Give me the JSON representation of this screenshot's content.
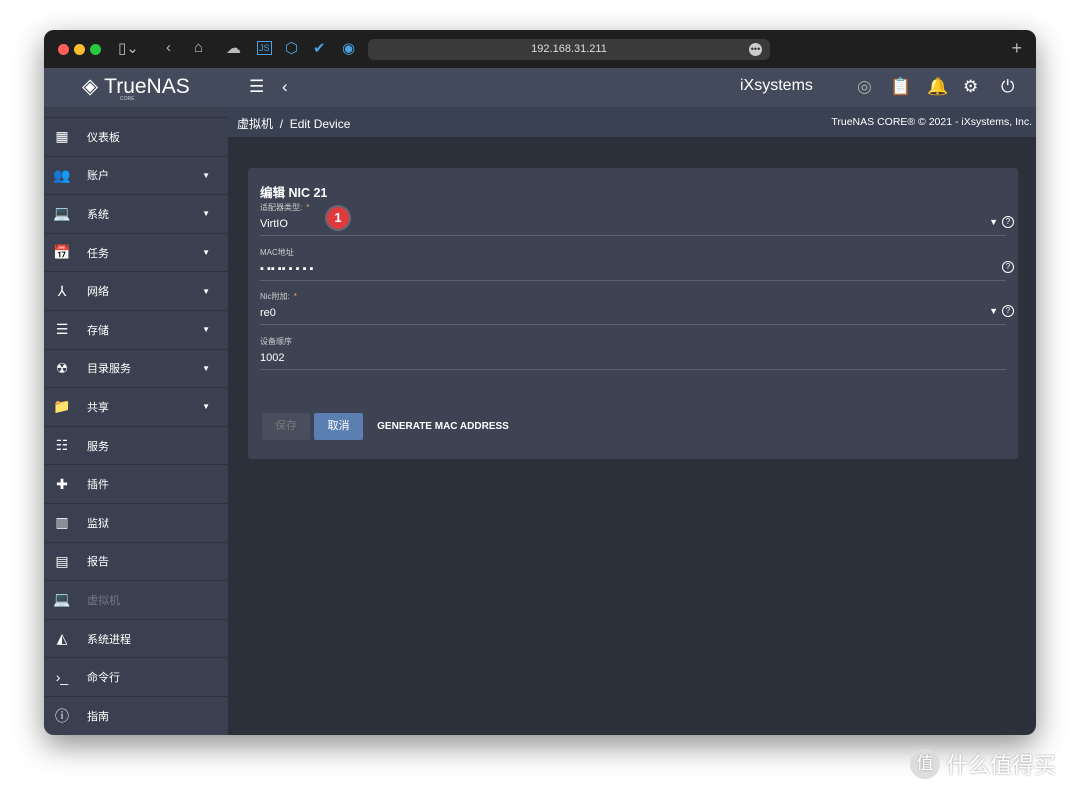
{
  "browser": {
    "url": "192.168.31.211"
  },
  "header": {
    "brand": "TrueNAS",
    "brand_sub": "CORE",
    "partner": "iXsystems"
  },
  "breadcrumb": {
    "parent": "虚拟机",
    "separator": "/",
    "current": "Edit Device",
    "copyright": "TrueNAS CORE® © 2021 - iXsystems, Inc."
  },
  "sidebar": {
    "items": [
      {
        "label": "仪表板",
        "icon": "dashboard-icon",
        "caret": false
      },
      {
        "label": "账户",
        "icon": "people-icon",
        "caret": true
      },
      {
        "label": "系统",
        "icon": "laptop-icon",
        "caret": true
      },
      {
        "label": "任务",
        "icon": "calendar-icon",
        "caret": true
      },
      {
        "label": "网络",
        "icon": "network-icon",
        "caret": true
      },
      {
        "label": "存储",
        "icon": "list-icon",
        "caret": true
      },
      {
        "label": "目录服务",
        "icon": "directory-icon",
        "caret": true
      },
      {
        "label": "共享",
        "icon": "folder-share-icon",
        "caret": true
      },
      {
        "label": "服务",
        "icon": "sliders-icon",
        "caret": false
      },
      {
        "label": "插件",
        "icon": "puzzle-icon",
        "caret": false
      },
      {
        "label": "监狱",
        "icon": "jail-icon",
        "caret": false
      },
      {
        "label": "报告",
        "icon": "chart-icon",
        "caret": false
      },
      {
        "label": "虚拟机",
        "icon": "vm-icon",
        "caret": false,
        "active": true
      },
      {
        "label": "系统进程",
        "icon": "process-icon",
        "caret": false
      },
      {
        "label": "命令行",
        "icon": "shell-icon",
        "caret": false
      },
      {
        "label": "指南",
        "icon": "info-icon",
        "caret": false
      }
    ]
  },
  "form": {
    "title": "编辑 NIC 21",
    "fields": [
      {
        "label": "适配器类型:",
        "required": true,
        "value": "VirtIO",
        "dropdown": true
      },
      {
        "label": "MAC地址",
        "required": false,
        "value": "▪ ▪▪ ▪▪ ▪ ▪ ▪ ▪",
        "dropdown": false
      },
      {
        "label": "Nic附加:",
        "required": true,
        "value": "re0",
        "dropdown": true
      },
      {
        "label": "设备顺序",
        "required": false,
        "value": "1002",
        "dropdown": false
      }
    ],
    "buttons": {
      "save": "保存",
      "cancel": "取消",
      "generate": "GENERATE MAC ADDRESS"
    }
  },
  "annotation": {
    "badge": "1"
  },
  "watermark": {
    "icon": "值",
    "text": "什么值得买"
  }
}
